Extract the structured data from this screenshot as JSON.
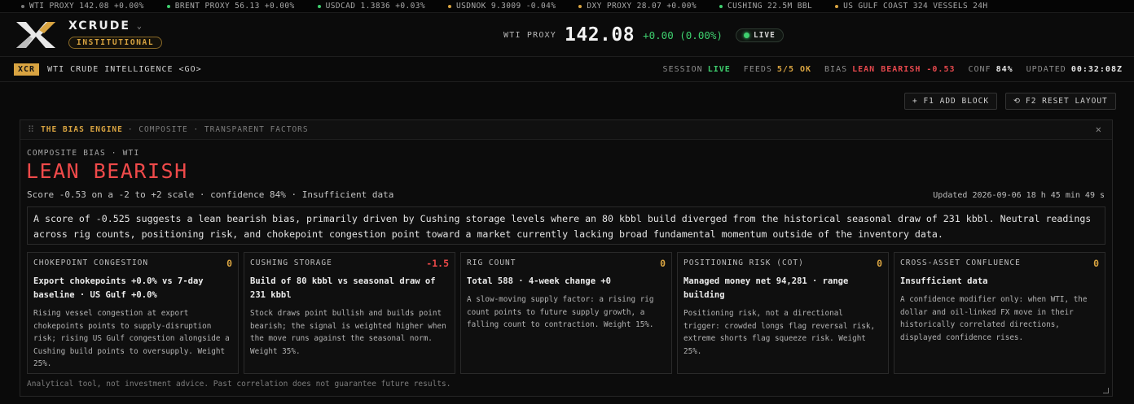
{
  "ticker": [
    {
      "text": "WTI PROXY 142.08 +0.00%",
      "color": "dim"
    },
    {
      "text": "BRENT PROXY 56.13 +0.00%",
      "color": "green"
    },
    {
      "text": "USDCAD 1.3836 +0.03%",
      "color": "green"
    },
    {
      "text": "USDNOK 9.3009 -0.04%",
      "color": "amber"
    },
    {
      "text": "DXY PROXY 28.07 +0.00%",
      "color": "amber"
    },
    {
      "text": "CUSHING 22.5M BBL",
      "color": "green"
    },
    {
      "text": "US GULF COAST 324 VESSELS 24H",
      "color": "amber"
    }
  ],
  "header": {
    "brand": "XCRUDE",
    "tier": "INSTITUTIONAL",
    "price_label": "WTI PROXY",
    "price": "142.08",
    "change": "+0.00 (0.00%)",
    "live": "LIVE"
  },
  "subbar": {
    "code": "XCR",
    "title": "WTI CRUDE INTELLIGENCE <GO>",
    "session_label": "SESSION",
    "session_value": "LIVE",
    "feeds_label": "FEEDS",
    "feeds_value": "5/5 OK",
    "bias_label": "BIAS",
    "bias_value": "LEAN BEARISH -0.53",
    "conf_label": "CONF",
    "conf_value": "84%",
    "updated_label": "UPDATED",
    "updated_value": "00:32:08Z"
  },
  "toolbar": {
    "add_label": "+ F1 ADD BLOCK",
    "reset_label": "F2 RESET LAYOUT"
  },
  "panel": {
    "title": "THE BIAS ENGINE",
    "subtitle": "· COMPOSITE · TRANSPARENT FACTORS",
    "composite_label": "COMPOSITE BIAS · WTI",
    "bias": "LEAN BEARISH",
    "score_line": "Score -0.53 on a -2 to +2 scale · confidence 84% · Insufficient data",
    "updated": "Updated 2026-09-06 18 h 45 min 49 s",
    "summary": "A score of -0.525 suggests a lean bearish bias, primarily driven by Cushing storage levels where an 80 kbbl build diverged from the historical seasonal draw of 231 kbbl. Neutral readings across rig counts, positioning risk, and chokepoint congestion point toward a market currently lacking broad fundamental momentum outside of the inventory data.",
    "factors": [
      {
        "title": "CHOKEPOINT CONGESTION",
        "score": "0",
        "headline": "Export chokepoints +0.0% vs 7-day baseline · US Gulf +0.0%",
        "body": "Rising vessel congestion at export chokepoints points to supply-disruption risk; rising US Gulf congestion alongside a Cushing build points to oversupply. Weight 25%."
      },
      {
        "title": "CUSHING STORAGE",
        "score": "-1.5",
        "headline": "Build of 80 kbbl vs seasonal draw of 231 kbbl",
        "body": "Stock draws point bullish and builds point bearish; the signal is weighted higher when the move runs against the seasonal norm. Weight 35%."
      },
      {
        "title": "RIG COUNT",
        "score": "0",
        "headline": "Total 588 · 4-week change +0",
        "body": "A slow-moving supply factor: a rising rig count points to future supply growth, a falling count to contraction. Weight 15%."
      },
      {
        "title": "POSITIONING RISK (COT)",
        "score": "0",
        "headline": "Managed money net 94,281 · range building",
        "body": "Positioning risk, not a directional trigger: crowded longs flag reversal risk, extreme shorts flag squeeze risk. Weight 25%."
      },
      {
        "title": "CROSS-ASSET CONFLUENCE",
        "score": "0",
        "headline": "Insufficient data",
        "body": "A confidence modifier only: when WTI, the dollar and oil-linked FX move in their historically correlated directions, displayed confidence rises."
      }
    ],
    "disclaimer": "Analytical tool, not investment advice. Past correlation does not guarantee future results."
  },
  "colors": {
    "accent_amber": "#d9a441",
    "bearish_red": "#ef4a4a",
    "live_green": "#3ecf6e"
  }
}
